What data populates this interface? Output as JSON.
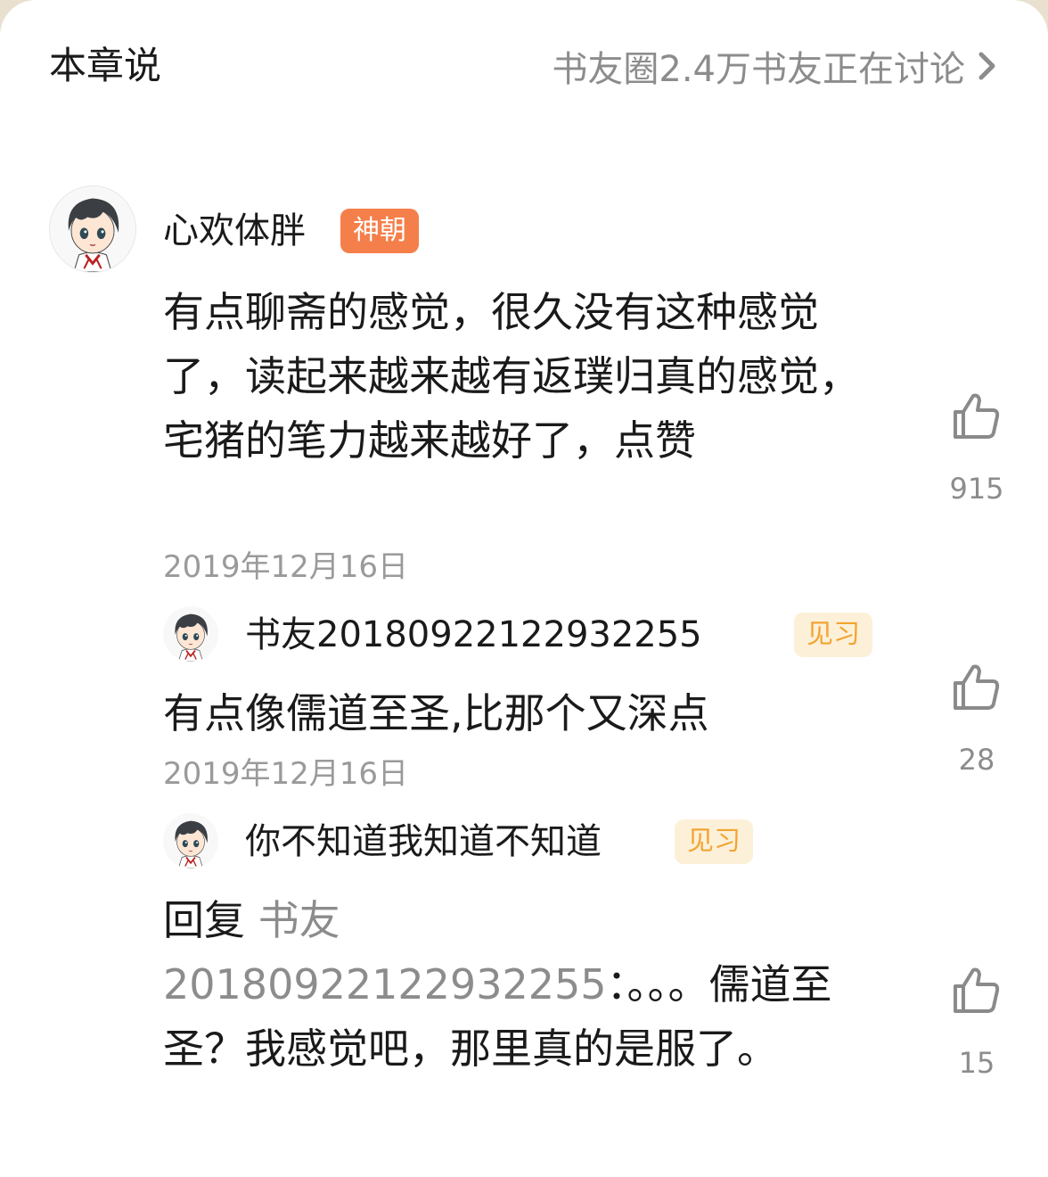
{
  "header": {
    "title": "本章说",
    "link_text": "书友圈2.4万书友正在讨论"
  },
  "comments": [
    {
      "username": "心欢体胖",
      "badge": "神朝",
      "text": "有点聊斋的感觉，很久没有这种感觉了，读起来越来越有返璞归真的感觉，宅猪的笔力越来越好了，点赞",
      "date": "2019年12月16日",
      "likes": "915"
    },
    {
      "username": "书友20180922122932255",
      "badge": "见习",
      "text": "有点像儒道至圣,比那个又深点",
      "date": "2019年12月16日",
      "likes": "28"
    },
    {
      "username": "你不知道我知道不知道",
      "badge": "见习",
      "reply_prefix": "回复",
      "reply_to": "书友20180922122932255",
      "text": "：。。。儒道至圣？我感觉吧，那里真的是服了。",
      "likes": "15"
    }
  ],
  "colors": {
    "badge_orange": "#f57f4a",
    "badge_light_bg": "#fdf0d9",
    "badge_light_text": "#f2a531",
    "secondary_text": "#8c8c8c"
  },
  "icons": [
    "chevron-right-icon",
    "thumbs-up-icon",
    "avatar"
  ]
}
